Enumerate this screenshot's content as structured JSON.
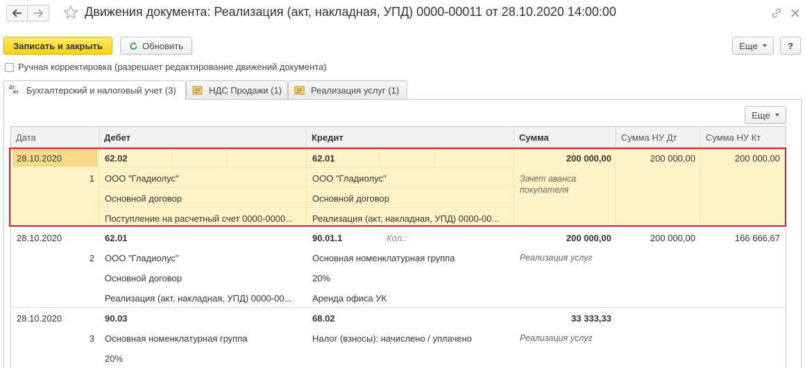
{
  "window": {
    "title": "Движения документа: Реализация (акт, накладная, УПД) 0000-00011 от 28.10.2020 14:00:00"
  },
  "toolbar": {
    "save_close_label": "Записать и закрыть",
    "refresh_label": "Обновить",
    "more_label": "Еще",
    "help_label": "?"
  },
  "manual_adjust": {
    "label": "Ручная корректировка (разрешает редактирование движений документа)",
    "checked": false
  },
  "tabs": [
    {
      "label": "Бухгалтерский и налоговый учет (3)",
      "icon": "dt-kt-icon",
      "active": true
    },
    {
      "label": "НДС Продажи (1)",
      "icon": "register-icon",
      "active": false
    },
    {
      "label": "Реализация услуг (1)",
      "icon": "register-icon",
      "active": false
    }
  ],
  "table": {
    "more_label": "Еще",
    "columns": [
      "Дата",
      "Дебет",
      "Кредит",
      "Сумма",
      "Сумма НУ Дт",
      "Сумма НУ Кт"
    ],
    "rows": [
      {
        "date": "28.10.2020",
        "num": "1",
        "debit": [
          "62.02",
          "ООО \"Гладиолус\"",
          "Основной договор",
          "Поступление на расчетный счет 0000-0000..."
        ],
        "credit": [
          "62.01",
          "ООО \"Гладиолус\"",
          "Основной договор",
          "Реализация (акт, накладная, УПД) 0000-00..."
        ],
        "qty_label": "",
        "amount": "200 000,00",
        "content": "Зачет аванса покупателя",
        "nu_dt": "200 000,00",
        "nu_kt": "200 000,00",
        "selected": true
      },
      {
        "date": "28.10.2020",
        "num": "2",
        "debit": [
          "62.01",
          "ООО \"Гладиолус\"",
          "Основной договор",
          "Реализация (акт, накладная, УПД) 0000-00..."
        ],
        "credit": [
          "90.01.1",
          "Основная номенклатурная группа",
          "20%",
          "Аренда офиса УК"
        ],
        "qty_label": "Кол.:",
        "amount": "200 000,00",
        "content": "Реализация услуг",
        "nu_dt": "200 000,00",
        "nu_kt": "166 666,67",
        "selected": false
      },
      {
        "date": "28.10.2020",
        "num": "3",
        "debit": [
          "90.03",
          "Основная номенклатурная группа",
          "20%",
          ""
        ],
        "credit": [
          "68.02",
          "Налог (взносы): начислено / уплачено",
          "",
          ""
        ],
        "qty_label": "",
        "amount": "33 333,33",
        "content": "Реализация услуг",
        "nu_dt": "",
        "nu_kt": "",
        "selected": false
      }
    ]
  },
  "colors": {
    "primary_button": "#f5d310",
    "selected_row": "#fef3c6",
    "highlight_border": "#d9232f"
  }
}
